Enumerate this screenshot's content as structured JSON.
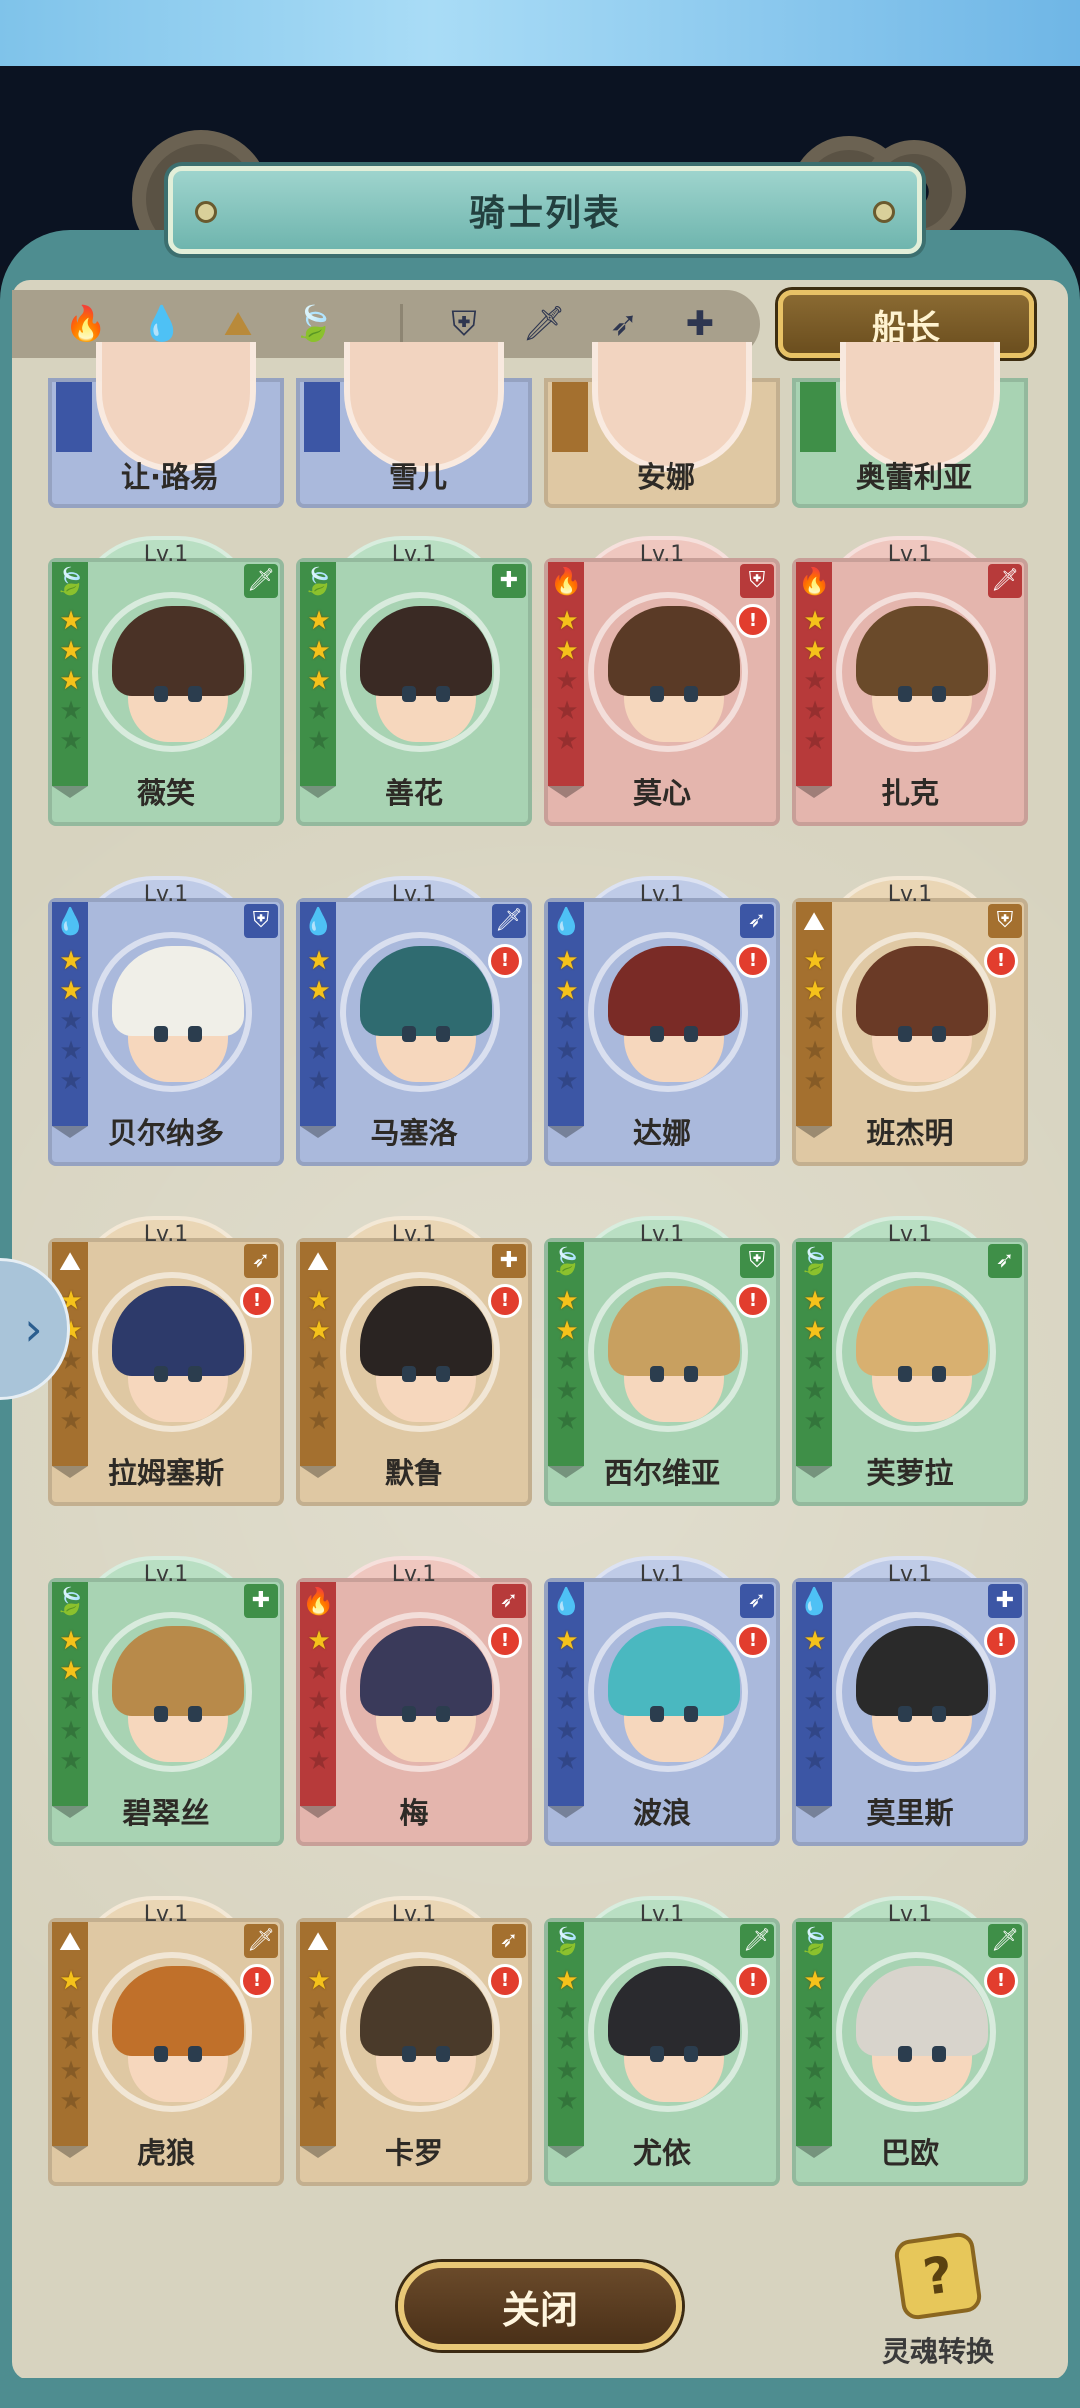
{
  "header": {
    "title": "骑士列表"
  },
  "filters": {
    "elements": [
      {
        "icon": "fire-element-icon",
        "glyph": "🔥"
      },
      {
        "icon": "water-element-icon",
        "glyph": "💧"
      },
      {
        "icon": "earth-element-icon",
        "glyph": "⛰"
      },
      {
        "icon": "wind-element-icon",
        "glyph": "🍃"
      }
    ],
    "classes": [
      {
        "icon": "shield-class-icon",
        "glyph": "⛨"
      },
      {
        "icon": "sword-class-icon",
        "glyph": "🗡"
      },
      {
        "icon": "bow-class-icon",
        "glyph": "➶"
      },
      {
        "icon": "healer-class-icon",
        "glyph": "✚"
      }
    ],
    "captain_label": "船长"
  },
  "partial_cards": [
    {
      "name": "让·路易",
      "color": "blue"
    },
    {
      "name": "雪儿",
      "color": "blue"
    },
    {
      "name": "安娜",
      "color": "brown"
    },
    {
      "name": "奥蕾利亚",
      "color": "green"
    }
  ],
  "cards": [
    {
      "name": "薇笑",
      "level": "Lv.1",
      "color": "green",
      "stars": 3,
      "alert": false,
      "cls_glyph": "🗡",
      "cls_icon": "sword-class-icon",
      "hair": "#4a3226"
    },
    {
      "name": "善花",
      "level": "Lv.1",
      "color": "green",
      "stars": 3,
      "alert": false,
      "cls_glyph": "✚",
      "cls_icon": "healer-class-icon",
      "hair": "#3a2a24"
    },
    {
      "name": "莫心",
      "level": "Lv.1",
      "color": "red",
      "stars": 2,
      "alert": true,
      "cls_glyph": "⛨",
      "cls_icon": "shield-class-icon",
      "hair": "#5a3a26"
    },
    {
      "name": "扎克",
      "level": "Lv.1",
      "color": "red",
      "stars": 2,
      "alert": false,
      "cls_glyph": "🗡",
      "cls_icon": "sword-class-icon",
      "hair": "#6a4a2a"
    },
    {
      "name": "贝尔纳多",
      "level": "Lv.1",
      "color": "blue",
      "stars": 2,
      "alert": false,
      "cls_glyph": "⛨",
      "cls_icon": "shield-class-icon",
      "hair": "#f0efe8"
    },
    {
      "name": "马塞洛",
      "level": "Lv.1",
      "color": "blue",
      "stars": 2,
      "alert": true,
      "cls_glyph": "🗡",
      "cls_icon": "sword-class-icon",
      "hair": "#2f6b70"
    },
    {
      "name": "达娜",
      "level": "Lv.1",
      "color": "blue",
      "stars": 2,
      "alert": true,
      "cls_glyph": "➶",
      "cls_icon": "bow-class-icon",
      "hair": "#7a2b26"
    },
    {
      "name": "班杰明",
      "level": "Lv.1",
      "color": "brown",
      "stars": 2,
      "alert": true,
      "cls_glyph": "⛨",
      "cls_icon": "shield-class-icon",
      "hair": "#6a3a26"
    },
    {
      "name": "拉姆塞斯",
      "level": "Lv.1",
      "color": "brown",
      "stars": 2,
      "alert": true,
      "cls_glyph": "➶",
      "cls_icon": "bow-class-icon",
      "hair": "#2d3a6a"
    },
    {
      "name": "默鲁",
      "level": "Lv.1",
      "color": "brown",
      "stars": 2,
      "alert": true,
      "cls_glyph": "✚",
      "cls_icon": "healer-class-icon",
      "hair": "#2a2422"
    },
    {
      "name": "西尔维亚",
      "level": "Lv.1",
      "color": "green",
      "stars": 2,
      "alert": true,
      "cls_glyph": "⛨",
      "cls_icon": "shield-class-icon",
      "hair": "#c8a060"
    },
    {
      "name": "芙萝拉",
      "level": "Lv.1",
      "color": "green",
      "stars": 2,
      "alert": false,
      "cls_glyph": "➶",
      "cls_icon": "bow-class-icon",
      "hair": "#d8b070"
    },
    {
      "name": "碧翠丝",
      "level": "Lv.1",
      "color": "green",
      "stars": 2,
      "alert": false,
      "cls_glyph": "✚",
      "cls_icon": "healer-class-icon",
      "hair": "#b88a4a"
    },
    {
      "name": "梅",
      "level": "Lv.1",
      "color": "red",
      "stars": 1,
      "alert": true,
      "cls_glyph": "➶",
      "cls_icon": "bow-class-icon",
      "hair": "#3a3a5a"
    },
    {
      "name": "波浪",
      "level": "Lv.1",
      "color": "blue",
      "stars": 1,
      "alert": true,
      "cls_glyph": "➶",
      "cls_icon": "bow-class-icon",
      "hair": "#4ab8c0"
    },
    {
      "name": "莫里斯",
      "level": "Lv.1",
      "color": "blue",
      "stars": 1,
      "alert": true,
      "cls_glyph": "✚",
      "cls_icon": "healer-class-icon",
      "hair": "#2a2a2a"
    },
    {
      "name": "虎狼",
      "level": "Lv.1",
      "color": "brown",
      "stars": 1,
      "alert": true,
      "cls_glyph": "🗡",
      "cls_icon": "sword-class-icon",
      "hair": "#c0702a"
    },
    {
      "name": "卡罗",
      "level": "Lv.1",
      "color": "brown",
      "stars": 1,
      "alert": true,
      "cls_glyph": "➶",
      "cls_icon": "bow-class-icon",
      "hair": "#4a3a2a"
    },
    {
      "name": "尤依",
      "level": "Lv.1",
      "color": "green",
      "stars": 1,
      "alert": true,
      "cls_glyph": "🗡",
      "cls_icon": "sword-class-icon",
      "hair": "#2a2a2e"
    },
    {
      "name": "巴欧",
      "level": "Lv.1",
      "color": "green",
      "stars": 1,
      "alert": true,
      "cls_glyph": "🗡",
      "cls_icon": "sword-class-icon",
      "hair": "#d8d4cc"
    }
  ],
  "element_glyphs": {
    "green": "🍃",
    "red": "🔥",
    "blue": "💧",
    "brown": "⛰"
  },
  "footer": {
    "close_label": "关闭",
    "soul_label": "灵魂转换",
    "soul_glyph": "?"
  },
  "side_tab_glyph": "›"
}
